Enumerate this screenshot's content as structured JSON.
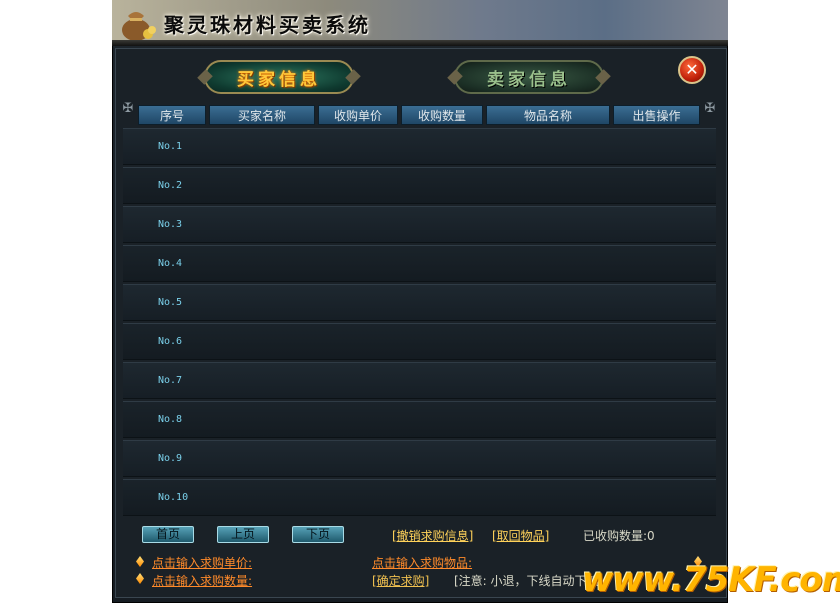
{
  "window": {
    "title": "聚灵珠材料买卖系统"
  },
  "tabs": {
    "buyer": "买家信息",
    "seller": "卖家信息"
  },
  "close_glyph": "✕",
  "table": {
    "columns": [
      "序号",
      "买家名称",
      "收购单价",
      "收购数量",
      "物品名称",
      "出售操作"
    ],
    "rows": [
      "No.1",
      "No.2",
      "No.3",
      "No.4",
      "No.5",
      "No.6",
      "No.7",
      "No.8",
      "No.9",
      "No.10"
    ]
  },
  "pager": {
    "first": "首页",
    "prev": "上页",
    "next": "下页"
  },
  "actions": {
    "cancel_request": "[撤销求购信息]",
    "retrieve_items": "[取回物品]",
    "purchased_count": "已收购数量:0",
    "input_price": "点击输入求购单价:",
    "input_quantity": "点击输入求购数量:",
    "input_item": "点击输入求购物品:",
    "confirm_request": "[确定求购]",
    "notice": "[注意: 小退，下线自动下架!"
  },
  "watermark": "www.75KF.com",
  "colors": {
    "header_blue": "#2c5a7e",
    "row_number": "#7ad0ea",
    "link_yellow": "#ffd25a",
    "link_orange": "#ff8a2a",
    "notice_green": "#4fe04f",
    "watermark": "#ffb400"
  }
}
